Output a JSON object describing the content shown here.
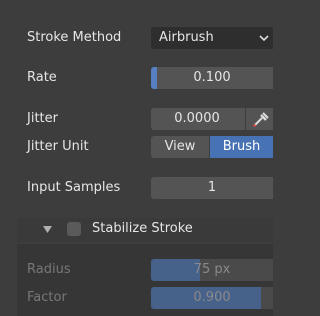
{
  "stroke_method": {
    "label": "Stroke Method",
    "value": "Airbrush"
  },
  "rate": {
    "label": "Rate",
    "value": "0.100",
    "fill": 0.05
  },
  "jitter": {
    "label": "Jitter",
    "value": "0.0000"
  },
  "jitter_unit": {
    "label": "Jitter Unit",
    "options": [
      "View",
      "Brush"
    ],
    "selected": "Brush"
  },
  "input_samples": {
    "label": "Input Samples",
    "value": "1"
  },
  "stabilize": {
    "label": "Stabilize Stroke",
    "checked": false
  },
  "radius": {
    "label": "Radius",
    "value": "75 px",
    "fill": 0.4
  },
  "factor": {
    "label": "Factor",
    "value": "0.900",
    "fill": 0.9
  },
  "colors": {
    "panel_bg": "#3d3d3d",
    "field_bg": "#545454",
    "dropdown_bg": "#2e2e2e",
    "accent": "#5680c2",
    "selected_segment": "#4772b3"
  },
  "icons": {
    "dropdown": "chevron-down-icon",
    "eyedropper": "eyedropper-icon",
    "expand": "triangle-down-icon"
  }
}
